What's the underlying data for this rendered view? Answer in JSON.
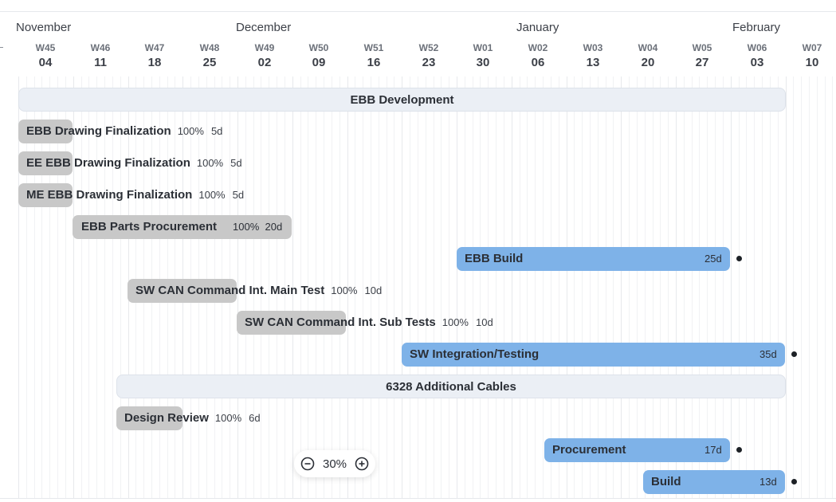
{
  "timeline": {
    "months": [
      "November",
      "December",
      "January",
      "February"
    ],
    "weeks": [
      "W45",
      "W46",
      "W47",
      "W48",
      "W49",
      "W50",
      "W51",
      "W52",
      "W01",
      "W02",
      "W03",
      "W04",
      "W05",
      "W06",
      "W07"
    ],
    "days": [
      "04",
      "11",
      "18",
      "25",
      "02",
      "09",
      "16",
      "23",
      "30",
      "06",
      "13",
      "20",
      "27",
      "03",
      "10"
    ]
  },
  "groups": [
    {
      "name": "EBB Development"
    },
    {
      "name": "6328 Additional Cables"
    }
  ],
  "tasks": [
    {
      "name": "EBB Drawing Finalization",
      "progress": "100%",
      "duration": "5d"
    },
    {
      "name": "EE EBB Drawing Finalization",
      "progress": "100%",
      "duration": "5d"
    },
    {
      "name": "ME EBB Drawing Finalization",
      "progress": "100%",
      "duration": "5d"
    },
    {
      "name": "EBB Parts Procurement",
      "progress": "100%",
      "duration": "20d"
    },
    {
      "name": "EBB Build",
      "duration": "25d"
    },
    {
      "name": "SW CAN Command Int. Main Test",
      "progress": "100%",
      "duration": "10d"
    },
    {
      "name": "SW CAN Command Int. Sub Tests",
      "progress": "100%",
      "duration": "10d"
    },
    {
      "name": "SW Integration/Testing",
      "duration": "35d"
    },
    {
      "name": "Design Review",
      "progress": "100%",
      "duration": "6d"
    },
    {
      "name": "Procurement",
      "duration": "17d"
    },
    {
      "name": "Build",
      "duration": "13d"
    }
  ],
  "zoom": {
    "value": "30%",
    "minus_icon": "zoom-out-icon",
    "plus_icon": "zoom-in-icon"
  },
  "colors": {
    "completed_bar": "#c8c8c8",
    "active_bar": "#7eb2e8",
    "group_bar": "#ebeff5"
  }
}
